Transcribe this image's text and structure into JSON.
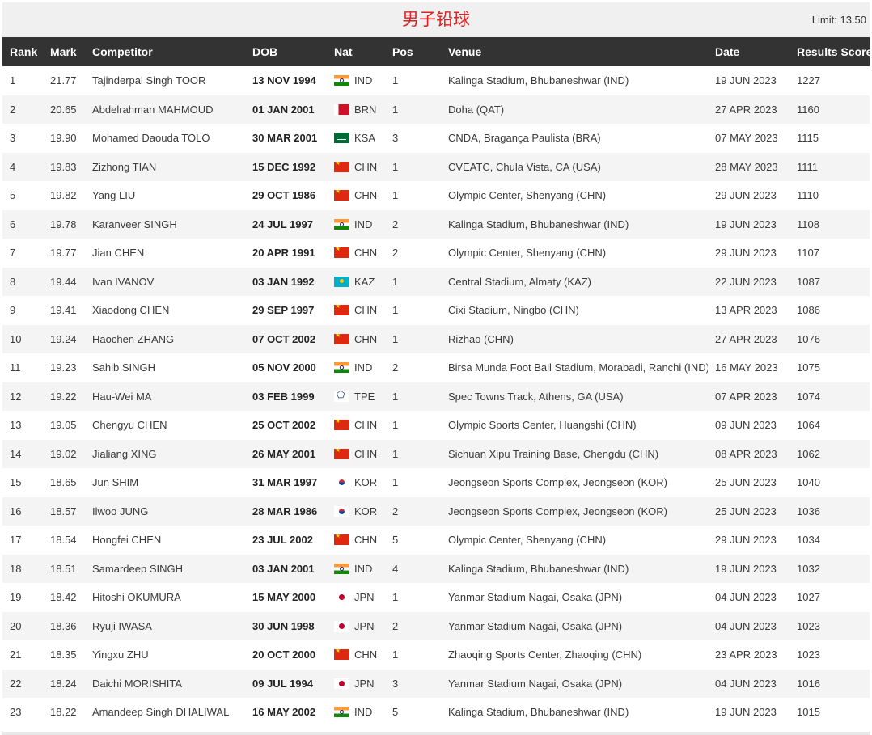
{
  "header": {
    "title": "男子铅球",
    "limit": "Limit: 13.50"
  },
  "columns": [
    "Rank",
    "Mark",
    "Competitor",
    "DOB",
    "Nat",
    "Pos",
    "Venue",
    "Date",
    "Results Score"
  ],
  "rows": [
    {
      "rank": "1",
      "mark": "21.77",
      "competitor": "Tajinderpal Singh TOOR",
      "dob": "13 NOV 1994",
      "nat": "IND",
      "pos": "1",
      "venue": "Kalinga Stadium, Bhubaneshwar (IND)",
      "date": "19 JUN 2023",
      "score": "1227"
    },
    {
      "rank": "2",
      "mark": "20.65",
      "competitor": "Abdelrahman MAHMOUD",
      "dob": "01 JAN 2001",
      "nat": "BRN",
      "pos": "1",
      "venue": "Doha (QAT)",
      "date": "27 APR 2023",
      "score": "1160"
    },
    {
      "rank": "3",
      "mark": "19.90",
      "competitor": "Mohamed Daouda TOLO",
      "dob": "30 MAR 2001",
      "nat": "KSA",
      "pos": "3",
      "venue": "CNDA, Bragança Paulista (BRA)",
      "date": "07 MAY 2023",
      "score": "1115"
    },
    {
      "rank": "4",
      "mark": "19.83",
      "competitor": "Zizhong TIAN",
      "dob": "15 DEC 1992",
      "nat": "CHN",
      "pos": "1",
      "venue": "CVEATC, Chula Vista, CA (USA)",
      "date": "28 MAY 2023",
      "score": "1111"
    },
    {
      "rank": "5",
      "mark": "19.82",
      "competitor": "Yang LIU",
      "dob": "29 OCT 1986",
      "nat": "CHN",
      "pos": "1",
      "venue": "Olympic Center, Shenyang (CHN)",
      "date": "29 JUN 2023",
      "score": "1110"
    },
    {
      "rank": "6",
      "mark": "19.78",
      "competitor": "Karanveer SINGH",
      "dob": "24 JUL 1997",
      "nat": "IND",
      "pos": "2",
      "venue": "Kalinga Stadium, Bhubaneshwar (IND)",
      "date": "19 JUN 2023",
      "score": "1108"
    },
    {
      "rank": "7",
      "mark": "19.77",
      "competitor": "Jian CHEN",
      "dob": "20 APR 1991",
      "nat": "CHN",
      "pos": "2",
      "venue": "Olympic Center, Shenyang (CHN)",
      "date": "29 JUN 2023",
      "score": "1107"
    },
    {
      "rank": "8",
      "mark": "19.44",
      "competitor": "Ivan IVANOV",
      "dob": "03 JAN 1992",
      "nat": "KAZ",
      "pos": "1",
      "venue": "Central Stadium, Almaty (KAZ)",
      "date": "22 JUN 2023",
      "score": "1087"
    },
    {
      "rank": "9",
      "mark": "19.41",
      "competitor": "Xiaodong CHEN",
      "dob": "29 SEP 1997",
      "nat": "CHN",
      "pos": "1",
      "venue": "Cixi Stadium, Ningbo (CHN)",
      "date": "13 APR 2023",
      "score": "1086"
    },
    {
      "rank": "10",
      "mark": "19.24",
      "competitor": "Haochen ZHANG",
      "dob": "07 OCT 2002",
      "nat": "CHN",
      "pos": "1",
      "venue": "Rizhao (CHN)",
      "date": "27 APR 2023",
      "score": "1076"
    },
    {
      "rank": "11",
      "mark": "19.23",
      "competitor": "Sahib SINGH",
      "dob": "05 NOV 2000",
      "nat": "IND",
      "pos": "2",
      "venue": "Birsa Munda Foot Ball Stadium, Morabadi, Ranchi (IND)",
      "date": "16 MAY 2023",
      "score": "1075"
    },
    {
      "rank": "12",
      "mark": "19.22",
      "competitor": "Hau-Wei MA",
      "dob": "03 FEB 1999",
      "nat": "TPE",
      "pos": "1",
      "venue": "Spec Towns Track, Athens, GA (USA)",
      "date": "07 APR 2023",
      "score": "1074"
    },
    {
      "rank": "13",
      "mark": "19.05",
      "competitor": "Chengyu CHEN",
      "dob": "25 OCT 2002",
      "nat": "CHN",
      "pos": "1",
      "venue": "Olympic Sports Center, Huangshi (CHN)",
      "date": "09 JUN 2023",
      "score": "1064"
    },
    {
      "rank": "14",
      "mark": "19.02",
      "competitor": "Jialiang XING",
      "dob": "26 MAY 2001",
      "nat": "CHN",
      "pos": "1",
      "venue": "Sichuan Xipu Training Base, Chengdu (CHN)",
      "date": "08 APR 2023",
      "score": "1062"
    },
    {
      "rank": "15",
      "mark": "18.65",
      "competitor": "Jun SHIM",
      "dob": "31 MAR 1997",
      "nat": "KOR",
      "pos": "1",
      "venue": "Jeongseon Sports Complex, Jeongseon (KOR)",
      "date": "25 JUN 2023",
      "score": "1040"
    },
    {
      "rank": "16",
      "mark": "18.57",
      "competitor": "Ilwoo JUNG",
      "dob": "28 MAR 1986",
      "nat": "KOR",
      "pos": "2",
      "venue": "Jeongseon Sports Complex, Jeongseon (KOR)",
      "date": "25 JUN 2023",
      "score": "1036"
    },
    {
      "rank": "17",
      "mark": "18.54",
      "competitor": "Hongfei CHEN",
      "dob": "23 JUL 2002",
      "nat": "CHN",
      "pos": "5",
      "venue": "Olympic Center, Shenyang (CHN)",
      "date": "29 JUN 2023",
      "score": "1034"
    },
    {
      "rank": "18",
      "mark": "18.51",
      "competitor": "Samardeep SINGH",
      "dob": "03 JAN 2001",
      "nat": "IND",
      "pos": "4",
      "venue": "Kalinga Stadium, Bhubaneshwar (IND)",
      "date": "19 JUN 2023",
      "score": "1032"
    },
    {
      "rank": "19",
      "mark": "18.42",
      "competitor": "Hitoshi OKUMURA",
      "dob": "15 MAY 2000",
      "nat": "JPN",
      "pos": "1",
      "venue": "Yanmar Stadium Nagai, Osaka (JPN)",
      "date": "04 JUN 2023",
      "score": "1027"
    },
    {
      "rank": "20",
      "mark": "18.36",
      "competitor": "Ryuji IWASA",
      "dob": "30 JUN 1998",
      "nat": "JPN",
      "pos": "2",
      "venue": "Yanmar Stadium Nagai, Osaka (JPN)",
      "date": "04 JUN 2023",
      "score": "1023"
    },
    {
      "rank": "21",
      "mark": "18.35",
      "competitor": "Yingxu ZHU",
      "dob": "20 OCT 2000",
      "nat": "CHN",
      "pos": "1",
      "venue": "Zhaoqing Sports Center, Zhaoqing (CHN)",
      "date": "23 APR 2023",
      "score": "1023"
    },
    {
      "rank": "22",
      "mark": "18.24",
      "competitor": "Daichi MORISHITA",
      "dob": "09 JUL 1994",
      "nat": "JPN",
      "pos": "3",
      "venue": "Yanmar Stadium Nagai, Osaka (JPN)",
      "date": "04 JUN 2023",
      "score": "1016"
    },
    {
      "rank": "23",
      "mark": "18.22",
      "competitor": "Amandeep Singh DHALIWAL",
      "dob": "16 MAY 2002",
      "nat": "IND",
      "pos": "5",
      "venue": "Kalinga Stadium, Bhubaneshwar (IND)",
      "date": "19 JUN 2023",
      "score": "1015"
    }
  ],
  "colors": {
    "title": "#e02020",
    "header_bg": "#333333",
    "row_alt": "#f4f4f4"
  }
}
